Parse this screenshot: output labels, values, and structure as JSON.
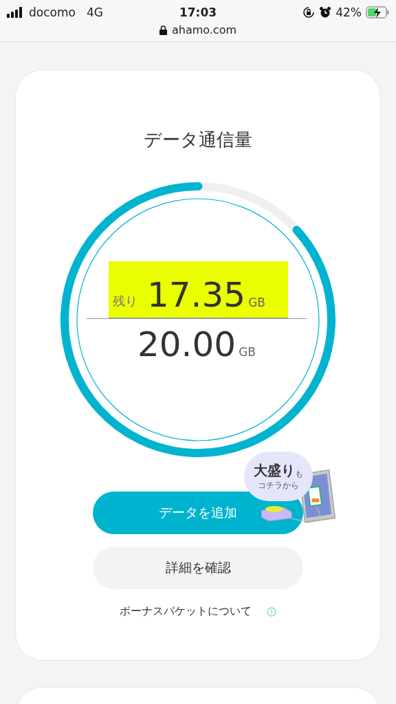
{
  "status_bar": {
    "carrier": "docomo",
    "network": "4G",
    "time": "17:03",
    "battery": "42%",
    "url": "ahamo.com"
  },
  "data_card": {
    "title": "データ通信量",
    "usage": {
      "remaining_label": "残り",
      "remaining": "17.35",
      "remaining_unit": "GB",
      "total": "20.00",
      "total_unit": "GB",
      "level": 0.8675
    },
    "promo": {
      "headline": "大盛り",
      "particle": "も",
      "subline": "コチラから"
    },
    "buttons": [
      {
        "label": "データを追加",
        "kind": "primary"
      },
      {
        "label": "詳細を確認",
        "kind": "secondary"
      }
    ],
    "info_link": "ボーナスパケットについて"
  }
}
